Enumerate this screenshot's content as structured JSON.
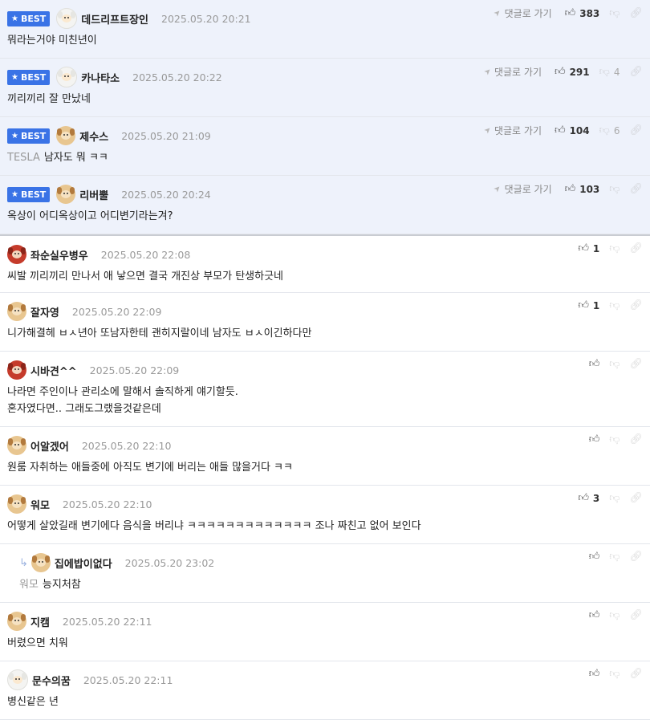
{
  "labels": {
    "best": "BEST",
    "goto": "댓글로 가기"
  },
  "comments": [
    {
      "nick": "데드리프트장인",
      "date": "2025.05.20 20:21",
      "best": true,
      "avatar": "white",
      "likes": "383",
      "hates": "",
      "lines": [
        "뭐라는거야 미친년이"
      ],
      "prefix": ""
    },
    {
      "nick": "카나타소",
      "date": "2025.05.20 20:22",
      "best": true,
      "avatar": "white",
      "likes": "291",
      "hates": "4",
      "lines": [
        "끼리끼리 잘 만났네"
      ],
      "prefix": ""
    },
    {
      "nick": "제수스",
      "date": "2025.05.20 21:09",
      "best": true,
      "avatar": "puppy",
      "likes": "104",
      "hates": "6",
      "lines": [
        "남자도 뭐 ㅋㅋ"
      ],
      "prefix": "TESLA"
    },
    {
      "nick": "리버뿔",
      "date": "2025.05.20 20:24",
      "best": true,
      "avatar": "puppy",
      "likes": "103",
      "hates": "",
      "lines": [
        "옥상이 어디옥상이고 어디변기라는겨?"
      ],
      "prefix": ""
    },
    {
      "nick": "좌순실우병우",
      "date": "2025.05.20 22:08",
      "best": false,
      "avatar": "red",
      "likes": "1",
      "hates": "",
      "lines": [
        "씨발 끼리끼리 만나서 애 낳으면 결국 개진상 부모가 탄생하긋네"
      ],
      "prefix": ""
    },
    {
      "nick": "잘자영",
      "date": "2025.05.20 22:09",
      "best": false,
      "avatar": "puppy",
      "likes": "1",
      "hates": "",
      "lines": [
        "니가해결헤 ㅂㅅ년아 또남자한테 괜히지랄이네 남자도 ㅂㅅ이긴하다만"
      ],
      "prefix": ""
    },
    {
      "nick": "시바견^^",
      "date": "2025.05.20 22:09",
      "best": false,
      "avatar": "red",
      "likes": "",
      "hates": "",
      "lines": [
        "나라면 주인이나 관리소에 말해서 솔직하게 얘기할듯.",
        "혼자였다면.. 그래도그랬을것같은데"
      ],
      "prefix": ""
    },
    {
      "nick": "어알겠어",
      "date": "2025.05.20 22:10",
      "best": false,
      "avatar": "puppy",
      "likes": "",
      "hates": "",
      "lines": [
        "원룸 자취하는 애들중에 아직도 변기에 버리는 애들 많을거다 ㅋㅋ"
      ],
      "prefix": ""
    },
    {
      "nick": "워모",
      "date": "2025.05.20 22:10",
      "best": false,
      "avatar": "puppy",
      "likes": "3",
      "hates": "",
      "lines": [
        "어떻게 살았길래 변기에다 음식을 버리냐 ㅋㅋㅋㅋㅋㅋㅋㅋㅋㅋㅋㅋㅋ 조나 짜친고 없어 보인다"
      ],
      "prefix": ""
    },
    {
      "nick": "집에밥이없다",
      "date": "2025.05.20 23:02",
      "best": false,
      "avatar": "puppy",
      "likes": "",
      "hates": "",
      "lines": [
        "능지처참"
      ],
      "prefix": "워모",
      "reply": true
    },
    {
      "nick": "지캠",
      "date": "2025.05.20 22:11",
      "best": false,
      "avatar": "puppy",
      "likes": "",
      "hates": "",
      "lines": [
        "버렸으면 치워"
      ],
      "prefix": ""
    },
    {
      "nick": "문수의꿈",
      "date": "2025.05.20 22:11",
      "best": false,
      "avatar": "white",
      "likes": "",
      "hates": "",
      "lines": [
        "병신같은 년"
      ],
      "prefix": ""
    }
  ]
}
